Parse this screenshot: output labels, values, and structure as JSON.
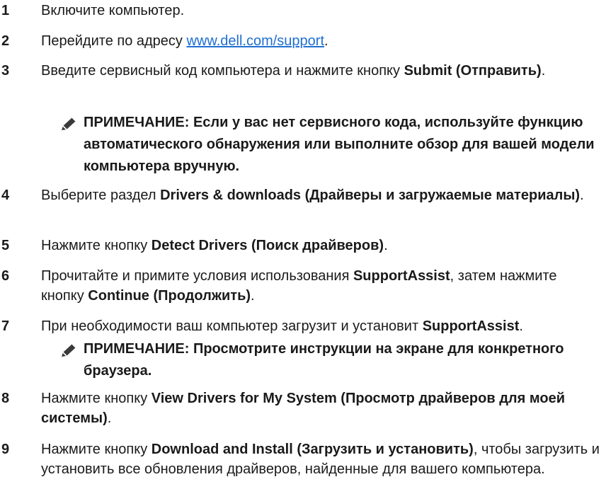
{
  "steps": [
    {
      "num": "1",
      "parts": [
        {
          "t": "Включите компьютер."
        }
      ]
    },
    {
      "num": "2",
      "parts": [
        {
          "t": "Перейдите по адресу "
        },
        {
          "t": "www.dell.com/support",
          "link": true
        },
        {
          "t": "."
        }
      ]
    },
    {
      "num": "3",
      "parts": [
        {
          "t": "Введите сервисный код компьютера и нажмите кнопку "
        },
        {
          "t": "Submit (Отправить)",
          "b": true
        },
        {
          "t": "."
        }
      ]
    },
    {
      "num": "4",
      "parts": [
        {
          "t": "Выберите раздел "
        },
        {
          "t": "Drivers & downloads (Драйверы и загружаемые материалы)",
          "b": true
        },
        {
          "t": "."
        }
      ]
    },
    {
      "num": "5",
      "parts": [
        {
          "t": "Нажмите кнопку "
        },
        {
          "t": "Detect Drivers (Поиск драйверов)",
          "b": true
        },
        {
          "t": "."
        }
      ]
    },
    {
      "num": "6",
      "parts": [
        {
          "t": "Прочитайте и примите условия использования "
        },
        {
          "t": "SupportAssist",
          "b": true
        },
        {
          "t": ", затем нажмите кнопку "
        },
        {
          "t": "Continue (Продолжить)",
          "b": true
        },
        {
          "t": "."
        }
      ]
    },
    {
      "num": "7",
      "parts": [
        {
          "t": "При необходимости ваш компьютер загрузит и установит "
        },
        {
          "t": "SupportAssist",
          "b": true
        },
        {
          "t": "."
        }
      ]
    },
    {
      "num": "8",
      "parts": [
        {
          "t": "Нажмите кнопку "
        },
        {
          "t": "View Drivers for My System (Просмотр драйверов для моей системы)",
          "b": true
        },
        {
          "t": "."
        }
      ]
    },
    {
      "num": "9",
      "parts": [
        {
          "t": "Нажмите кнопку "
        },
        {
          "t": "Download and Install (Загрузить и установить)",
          "b": true
        },
        {
          "t": ", чтобы загрузить и установить все обновления драйверов, найденные для вашего компьютера."
        }
      ]
    }
  ],
  "notes": [
    {
      "icon": "pencil-icon",
      "text": "ПРИМЕЧАНИЕ: Если у вас нет сервисного кода, используйте функцию автоматического обнаружения или выполните обзор для вашей модели компьютера вручную."
    },
    {
      "icon": "pencil-icon",
      "text": "ПРИМЕЧАНИЕ: Просмотрите инструкции на экране для конкретного браузера."
    }
  ]
}
